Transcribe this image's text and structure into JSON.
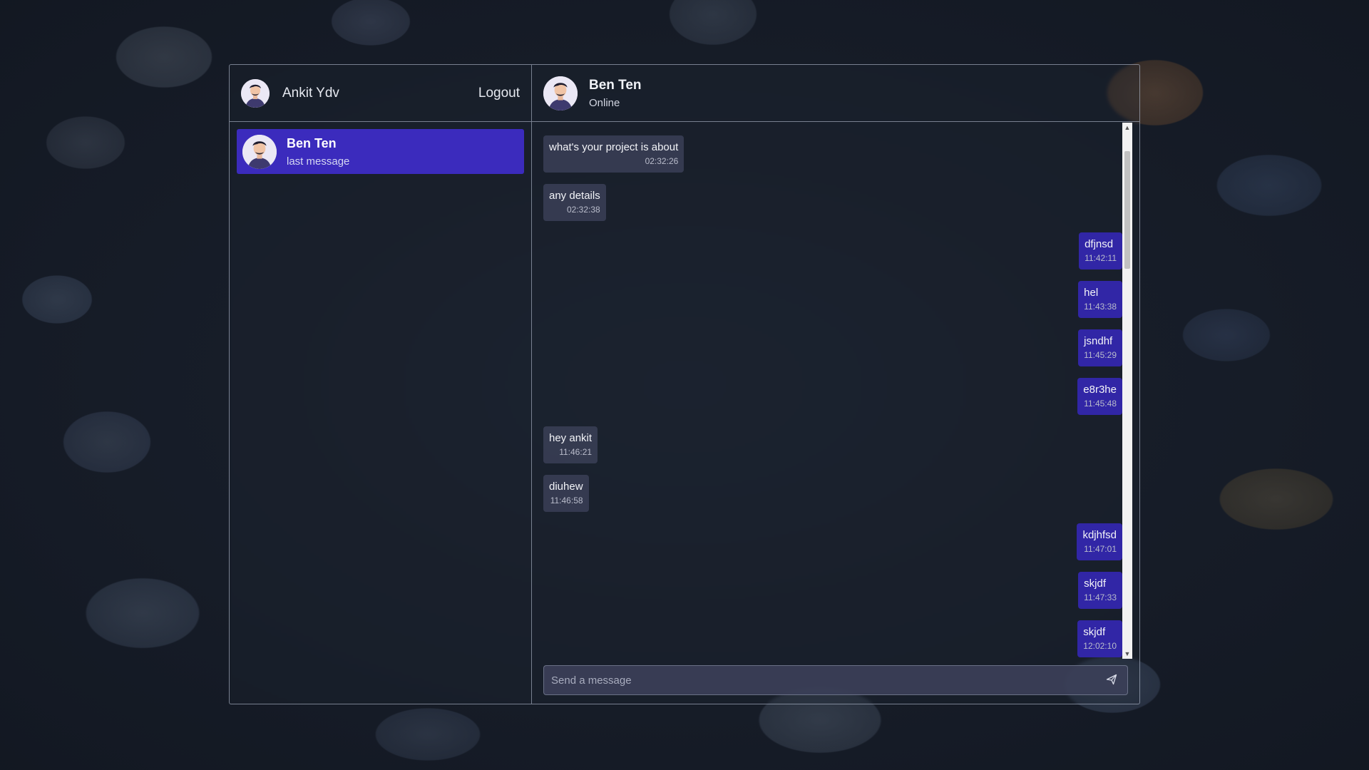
{
  "sidebar": {
    "user_name": "Ankit Ydv",
    "logout_label": "Logout",
    "contacts": [
      {
        "name": "Ben Ten",
        "last_message": "last message",
        "active": true
      }
    ]
  },
  "chat": {
    "contact_name": "Ben Ten",
    "status": "Online",
    "messages": [
      {
        "direction": "in",
        "text": "what's your project is about",
        "time": "02:32:26"
      },
      {
        "direction": "in",
        "text": "any details",
        "time": "02:32:38"
      },
      {
        "direction": "out",
        "text": "dfjnsd",
        "time": "11:42:11"
      },
      {
        "direction": "out",
        "text": "hel",
        "time": "11:43:38"
      },
      {
        "direction": "out",
        "text": "jsndhf",
        "time": "11:45:29"
      },
      {
        "direction": "out",
        "text": "e8r3he",
        "time": "11:45:48"
      },
      {
        "direction": "in",
        "text": "hey ankit",
        "time": "11:46:21"
      },
      {
        "direction": "in",
        "text": "diuhew",
        "time": "11:46:58"
      },
      {
        "direction": "out",
        "text": "kdjhfsd",
        "time": "11:47:01"
      },
      {
        "direction": "out",
        "text": "skjdf",
        "time": "11:47:33"
      },
      {
        "direction": "out",
        "text": "skjdf",
        "time": "12:02:10"
      }
    ],
    "composer": {
      "placeholder": "Send a message",
      "value": ""
    }
  },
  "icons": {
    "avatar": "user-avatar-icon",
    "send": "send-icon",
    "scroll_up": "scroll-up-arrow-icon",
    "scroll_down": "scroll-down-arrow-icon"
  },
  "colors": {
    "active_contact": "#3b2bbd",
    "outgoing_bubble": "#3126a6",
    "incoming_bubble": "#383e54"
  }
}
